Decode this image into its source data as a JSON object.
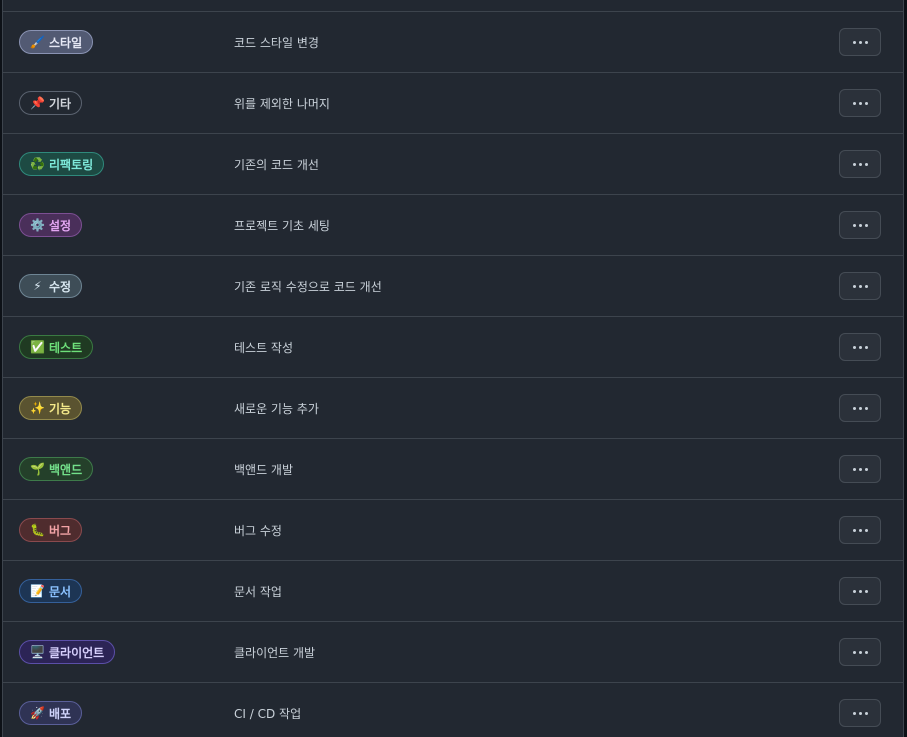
{
  "labels": [
    {
      "emoji": "🖌️",
      "name": "스타일",
      "description": "코드 스타일 변경",
      "bg": "#525a73",
      "fg": "#e6e8f5",
      "border": "#8a93b3"
    },
    {
      "emoji": "📌",
      "name": "기타",
      "description": "위를 제외한 나머지",
      "bg": "#222831",
      "fg": "#d0d4da",
      "border": "#5b6370"
    },
    {
      "emoji": "♻️",
      "name": "리팩토링",
      "description": "기존의 코드 개선",
      "bg": "#1d4a43",
      "fg": "#7eeadb",
      "border": "#2f8a7c"
    },
    {
      "emoji": "⚙️",
      "name": "설정",
      "description": "프로젝트 기초 세팅",
      "bg": "#4a2f5a",
      "fg": "#e3a6f2",
      "border": "#7c4f93"
    },
    {
      "emoji": "⚡",
      "name": "수정",
      "description": "기존 로직 수정으로 코드 개선",
      "bg": "#3e4d57",
      "fg": "#d7e6ef",
      "border": "#6e8594"
    },
    {
      "emoji": "✅",
      "name": "테스트",
      "description": "테스트 작성",
      "bg": "#1f3a22",
      "fg": "#6ee07a",
      "border": "#3a7a42"
    },
    {
      "emoji": "✨",
      "name": "기능",
      "description": "새로운 기능 추가",
      "bg": "#5a5330",
      "fg": "#f4e98a",
      "border": "#938a4c"
    },
    {
      "emoji": "🌱",
      "name": "백앤드",
      "description": "백앤드 개발",
      "bg": "#24402a",
      "fg": "#73e08a",
      "border": "#3e7a4a"
    },
    {
      "emoji": "🐛",
      "name": "버그",
      "description": "버그 수정",
      "bg": "#4f2c2e",
      "fg": "#f2a3a6",
      "border": "#8a4a4e"
    },
    {
      "emoji": "📝",
      "name": "문서",
      "description": "문서 작업",
      "bg": "#1d3554",
      "fg": "#8cc2ff",
      "border": "#35609a"
    },
    {
      "emoji": "🖥️",
      "name": "클라이언트",
      "description": "클라이언트 개발",
      "bg": "#2c2456",
      "fg": "#d6cffc",
      "border": "#5b4fa8"
    },
    {
      "emoji": "🚀",
      "name": "배포",
      "description": "CI / CD 작업",
      "bg": "#2f3354",
      "fg": "#cfd3fa",
      "border": "#5a5f99"
    }
  ],
  "row_menu_icon": "kebab-horizontal-icon"
}
